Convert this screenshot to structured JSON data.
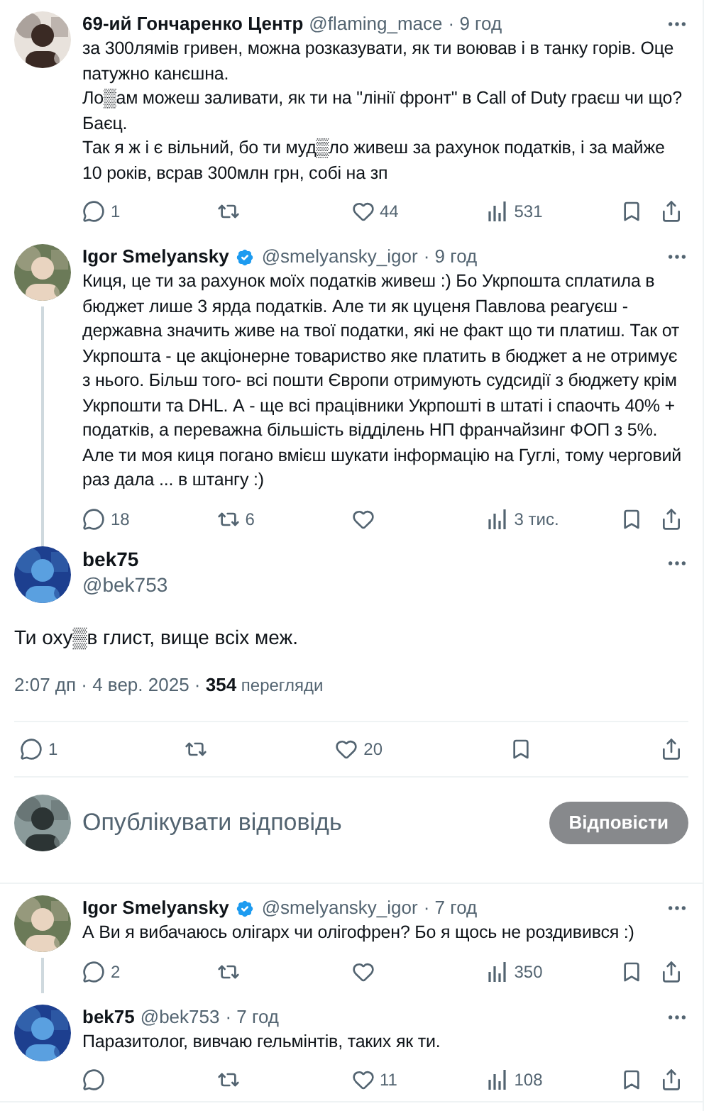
{
  "thread_top": [
    {
      "name": "69-ий Гончаренко Центр",
      "verified": false,
      "handle": "@flaming_mace",
      "time": "· 9 год",
      "connected": false,
      "paragraphs": [
        "за 300лямів гривен, можна розказувати, як ти воював і в танку горів. Оце патужно канєшна.",
        "Ло▒ам можеш заливати, як ти на \"лінії фронт\" в Call of Duty граєш чи що? Баєц.",
        "Так я ж і є вільний, бо ти муд▒ло живеш за рахунок податків, і за майже 10 років, всрав 300млн грн, собі на зп"
      ],
      "replies": "1",
      "likes": "44",
      "views": "531"
    },
    {
      "name": "Igor Smelyansky",
      "verified": true,
      "handle": "@smelyansky_igor",
      "time": "· 9 год",
      "connected": true,
      "paragraphs": [
        "Киця, це ти за рахунок моїх податків живеш :) Бо Укрпошта сплатила в бюджет лише 3 ярда податків. Але ти як цуценя Павлова реагуєш - державна значить живе на твої податки, які не факт що ти платиш. Так от Укрпошта - це акціонерне товариство яке платить в бюджет а не отримує з нього. Більш того- всі пошти Європи отримують судсидії з бюджету крім Укрпошти та DHL. А - ще всі працівники Укрпошті в штаті і спаочть 40% + податків, а переважна більшість відділень НП франчайзинг ФОП з 5%. Але ти моя киця погано вмієш шукати інформацію на Гуглі, тому черговий раз дала ... в штангу :)"
      ],
      "replies": "18",
      "retweets": "6",
      "views": "3 тис."
    }
  ],
  "main_tweet": {
    "name": "bek75",
    "handle": "@bek753",
    "text": "Ти оху▒в глист, вище всіх меж.",
    "timestamp": "2:07 дп · 4 вер. 2025 · ",
    "views": "354",
    "views_label": "перегляди",
    "replies": "1",
    "likes": "20"
  },
  "composer": {
    "placeholder": "Опублікувати відповідь",
    "button": "Відповісти",
    "disabled": true
  },
  "replies": [
    {
      "name": "Igor Smelyansky",
      "verified": true,
      "handle": "@smelyansky_igor",
      "time": "· 7 год",
      "connected": true,
      "paragraphs": [
        "А Ви я вибачаюсь олігарх чи олігофрен? Бо я щось не роздивився :)"
      ],
      "replies": "2",
      "views": "350"
    },
    {
      "name": "bek75",
      "verified": false,
      "handle": "@bek753",
      "time": "· 7 год",
      "connected": false,
      "paragraphs": [
        "Паразитолог, вивчаю гельмінтів, таких як ти."
      ],
      "likes": "11",
      "views": "108"
    }
  ]
}
